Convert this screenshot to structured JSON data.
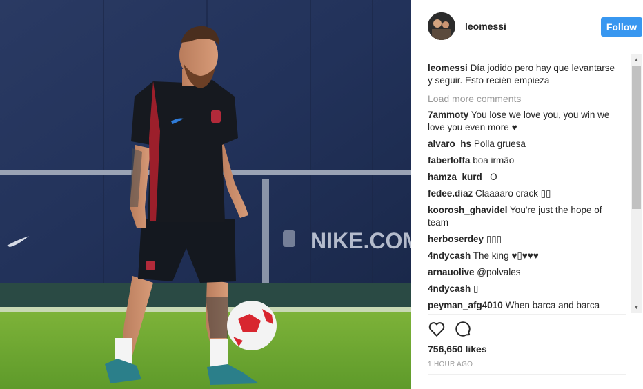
{
  "post": {
    "author": "leomessi",
    "follow_label": "Follow",
    "caption": {
      "user": "leomessi",
      "text": "Día jodido pero hay que levantarse y seguir. Esto recién empieza"
    },
    "load_more_label": "Load more comments",
    "comments": [
      {
        "user": "7ammoty",
        "text": "You lose we love you, you win we love you even more ♥"
      },
      {
        "user": "alvaro_hs",
        "text": "Polla gruesa"
      },
      {
        "user": "faberloffa",
        "text": "boa irmão"
      },
      {
        "user": "hamza_kurd_",
        "text": "O"
      },
      {
        "user": "fedee.diaz",
        "text": "Claaaaro crack ▯▯"
      },
      {
        "user": "koorosh_ghavidel",
        "text": "You're just the hope of team"
      },
      {
        "user": "herboserdey",
        "text": "▯▯▯"
      },
      {
        "user": "4ndycash",
        "text": "The king ♥▯♥♥♥"
      },
      {
        "user": "arnauolive",
        "text": "@polvales"
      },
      {
        "user": "4ndycash",
        "text": "▯"
      },
      {
        "user": "peyman_afg4010",
        "text": "When barca and barca"
      }
    ],
    "likes": "756,650 likes",
    "time": "1 HOUR AGO",
    "photo_text": {
      "banner": "NIKE.COM/FC"
    },
    "icons": {
      "like": "heart-icon",
      "comment": "comment-icon",
      "scroll_up": "chevron-up-icon",
      "scroll_down": "chevron-down-icon"
    },
    "colors": {
      "follow_button": "#3897f0",
      "muted_text": "#999999",
      "mention": "#003569"
    }
  }
}
